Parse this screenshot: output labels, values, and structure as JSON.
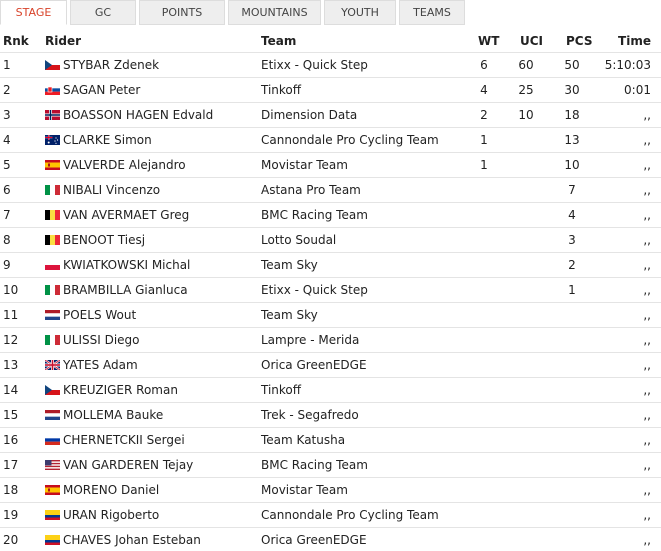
{
  "tabs": [
    "STAGE",
    "GC",
    "POINTS",
    "MOUNTAINS",
    "YOUTH",
    "TEAMS"
  ],
  "active_tab": "STAGE",
  "columns": {
    "rnk": "Rnk",
    "rider": "Rider",
    "team": "Team",
    "wt": "WT",
    "uci": "UCI",
    "pcs": "PCS",
    "time": "Time"
  },
  "rows": [
    {
      "rnk": "1",
      "flag": "cz",
      "rider": "STYBAR Zdenek",
      "team": "Etixx - Quick Step",
      "wt": "6",
      "uci": "60",
      "pcs": "50",
      "time": "5:10:03"
    },
    {
      "rnk": "2",
      "flag": "sk",
      "rider": "SAGAN Peter",
      "team": "Tinkoff",
      "wt": "4",
      "uci": "25",
      "pcs": "30",
      "time": "0:01"
    },
    {
      "rnk": "3",
      "flag": "no",
      "rider": "BOASSON HAGEN Edvald",
      "team": "Dimension Data",
      "wt": "2",
      "uci": "10",
      "pcs": "18",
      "time": ",,"
    },
    {
      "rnk": "4",
      "flag": "au",
      "rider": "CLARKE Simon",
      "team": "Cannondale Pro Cycling Team",
      "wt": "1",
      "uci": "",
      "pcs": "13",
      "time": ",,"
    },
    {
      "rnk": "5",
      "flag": "es",
      "rider": "VALVERDE Alejandro",
      "team": "Movistar Team",
      "wt": "1",
      "uci": "",
      "pcs": "10",
      "time": ",,"
    },
    {
      "rnk": "6",
      "flag": "it",
      "rider": "NIBALI Vincenzo",
      "team": "Astana Pro Team",
      "wt": "",
      "uci": "",
      "pcs": "7",
      "time": ",,"
    },
    {
      "rnk": "7",
      "flag": "be",
      "rider": "VAN AVERMAET Greg",
      "team": "BMC Racing Team",
      "wt": "",
      "uci": "",
      "pcs": "4",
      "time": ",,"
    },
    {
      "rnk": "8",
      "flag": "be",
      "rider": "BENOOT Tiesj",
      "team": "Lotto Soudal",
      "wt": "",
      "uci": "",
      "pcs": "3",
      "time": ",,"
    },
    {
      "rnk": "9",
      "flag": "pl",
      "rider": "KWIATKOWSKI Michal",
      "team": "Team Sky",
      "wt": "",
      "uci": "",
      "pcs": "2",
      "time": ",,"
    },
    {
      "rnk": "10",
      "flag": "it",
      "rider": "BRAMBILLA Gianluca",
      "team": "Etixx - Quick Step",
      "wt": "",
      "uci": "",
      "pcs": "1",
      "time": ",,"
    },
    {
      "rnk": "11",
      "flag": "nl",
      "rider": "POELS Wout",
      "team": "Team Sky",
      "wt": "",
      "uci": "",
      "pcs": "",
      "time": ",,"
    },
    {
      "rnk": "12",
      "flag": "it",
      "rider": "ULISSI Diego",
      "team": "Lampre - Merida",
      "wt": "",
      "uci": "",
      "pcs": "",
      "time": ",,"
    },
    {
      "rnk": "13",
      "flag": "gb",
      "rider": "YATES Adam",
      "team": "Orica GreenEDGE",
      "wt": "",
      "uci": "",
      "pcs": "",
      "time": ",,"
    },
    {
      "rnk": "14",
      "flag": "cz",
      "rider": "KREUZIGER Roman",
      "team": "Tinkoff",
      "wt": "",
      "uci": "",
      "pcs": "",
      "time": ",,"
    },
    {
      "rnk": "15",
      "flag": "nl",
      "rider": "MOLLEMA Bauke",
      "team": "Trek - Segafredo",
      "wt": "",
      "uci": "",
      "pcs": "",
      "time": ",,"
    },
    {
      "rnk": "16",
      "flag": "ru",
      "rider": "CHERNETCKII Sergei",
      "team": "Team Katusha",
      "wt": "",
      "uci": "",
      "pcs": "",
      "time": ",,"
    },
    {
      "rnk": "17",
      "flag": "us",
      "rider": "VAN GARDEREN Tejay",
      "team": "BMC Racing Team",
      "wt": "",
      "uci": "",
      "pcs": "",
      "time": ",,"
    },
    {
      "rnk": "18",
      "flag": "es",
      "rider": "MORENO Daniel",
      "team": "Movistar Team",
      "wt": "",
      "uci": "",
      "pcs": "",
      "time": ",,"
    },
    {
      "rnk": "19",
      "flag": "co",
      "rider": "URAN Rigoberto",
      "team": "Cannondale Pro Cycling Team",
      "wt": "",
      "uci": "",
      "pcs": "",
      "time": ",,"
    },
    {
      "rnk": "20",
      "flag": "co",
      "rider": "CHAVES Johan Esteban",
      "team": "Orica GreenEDGE",
      "wt": "",
      "uci": "",
      "pcs": "",
      "time": ",,"
    }
  ],
  "colors": {
    "active_tab_text": "#d8432a",
    "tab_bg": "#eeeeee",
    "row_border": "#e4e4e4"
  }
}
